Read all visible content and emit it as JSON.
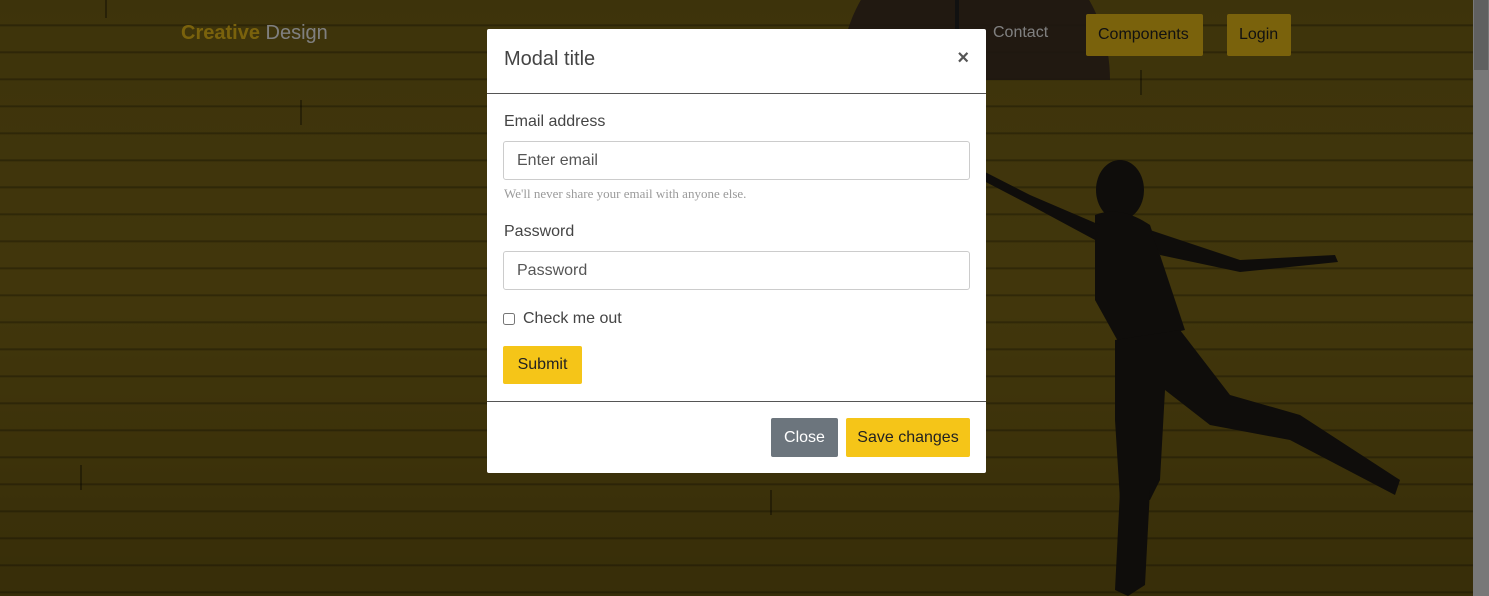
{
  "navbar": {
    "brand_part1": "Creative",
    "brand_part2": "Design",
    "contact_label": "Contact",
    "components_label": "Components",
    "login_label": "Login"
  },
  "modal": {
    "title": "Modal title",
    "close_symbol": "×",
    "email_label": "Email address",
    "email_placeholder": "Enter email",
    "email_help": "We'll never share your email with anyone else.",
    "password_label": "Password",
    "password_placeholder": "Password",
    "checkbox_label": "Check me out",
    "submit_label": "Submit",
    "close_button_label": "Close",
    "save_button_label": "Save changes"
  },
  "colors": {
    "accent": "#f5c518",
    "secondary": "#6c757d"
  }
}
